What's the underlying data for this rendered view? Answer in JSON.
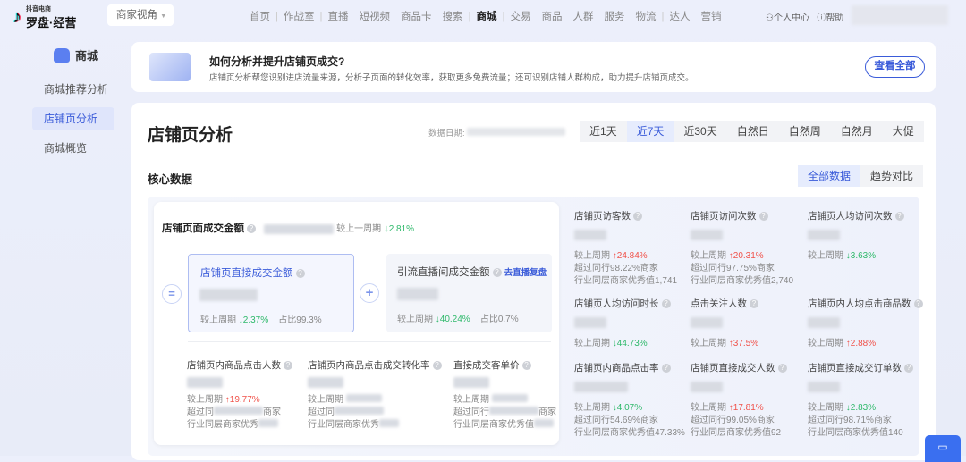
{
  "header": {
    "logo_small": "抖音电商",
    "logo": "罗盘·经营",
    "perspective": "商家视角",
    "nav": [
      "首页",
      "作战室",
      "直播",
      "短视频",
      "商品卡",
      "搜索",
      "商城",
      "交易",
      "商品",
      "人群",
      "服务",
      "物流",
      "达人",
      "营销"
    ],
    "active_nav": "商城",
    "personal": "个人中心",
    "help": "帮助"
  },
  "sidebar": {
    "title": "商城",
    "items": [
      "商城推荐分析",
      "店铺页分析",
      "商城概览"
    ],
    "active": "店铺页分析"
  },
  "banner": {
    "title": "如何分析并提升店铺页成交?",
    "desc": "店铺页分析帮您识别进店流量来源，分析子页面的转化效率，获取更多免费流量；还可识别店铺人群构成，助力提升店铺页成交。",
    "button": "查看全部"
  },
  "main": {
    "title": "店铺页分析",
    "date_label": "数据日期:",
    "filters": [
      "近1天",
      "近7天",
      "近30天",
      "自然日",
      "自然周",
      "自然月",
      "大促"
    ],
    "active_filter": "近7天",
    "section": "核心数据",
    "toggles": [
      "全部数据",
      "趋势对比"
    ],
    "active_toggle": "全部数据"
  },
  "total": {
    "label": "店铺页面成交金额",
    "compare": "较上一周期",
    "change": "2.81%"
  },
  "direct": {
    "label": "店铺页直接成交金额",
    "compare": "较上周期",
    "change": "2.37%",
    "share": "占比99.3%"
  },
  "live": {
    "label": "引流直播间成交金额",
    "link": "去直播复盘",
    "compare": "较上周期",
    "change": "40.24%",
    "share": "占比0.7%"
  },
  "sub": [
    {
      "label": "店铺页内商品点击人数",
      "compare": "较上周期",
      "change": "19.77%",
      "l2": "超过同",
      "l2b": "商家",
      "l3": "行业同层商家优秀"
    },
    {
      "label": "店铺页内商品点击成交转化率",
      "compare": "较上周期",
      "change": "",
      "l2": "超过同",
      "l2b": "",
      "l3": "行业同层商家优秀"
    },
    {
      "label": "直接成交客单价",
      "compare": "较上周期",
      "change": "",
      "l2": "超过同行",
      "l2b": "商家",
      "l3": "行业同层商家优秀值"
    }
  ],
  "metrics": [
    {
      "label": "店铺页访客数",
      "compare": "较上周期",
      "change": "24.84%",
      "dir": "up",
      "l2": "超过同行98.22%商家",
      "l3": "行业同层商家优秀值1,741"
    },
    {
      "label": "店铺页访问次数",
      "compare": "较上周期",
      "change": "20.31%",
      "dir": "up",
      "l2": "超过同行97.75%商家",
      "l3": "行业同层商家优秀值2,740"
    },
    {
      "label": "店铺页人均访问次数",
      "compare": "较上周期",
      "change": "3.63%",
      "dir": "dn",
      "l2": "",
      "l3": ""
    },
    {
      "label": "店铺页人均访问时长",
      "compare": "较上周期",
      "change": "44.73%",
      "dir": "dn",
      "l2": "",
      "l3": ""
    },
    {
      "label": "点击关注人数",
      "compare": "较上周期",
      "change": "37.5%",
      "dir": "up",
      "l2": "",
      "l3": ""
    },
    {
      "label": "店铺页内人均点击商品数",
      "compare": "较上周期",
      "change": "2.88%",
      "dir": "up",
      "l2": "",
      "l3": ""
    },
    {
      "label": "店铺页内商品点击率",
      "compare": "较上周期",
      "change": "4.07%",
      "dir": "dn",
      "l2": "超过同行54.69%商家",
      "l3": "行业同层商家优秀值47.33%"
    },
    {
      "label": "店铺页直接成交人数",
      "compare": "较上周期",
      "change": "17.81%",
      "dir": "up",
      "l2": "超过同行99.05%商家",
      "l3": "行业同层商家优秀值92"
    },
    {
      "label": "店铺页直接成交订单数",
      "compare": "较上周期",
      "change": "2.83%",
      "dir": "dn",
      "l2": "超过同行98.71%商家",
      "l3": "行业同层商家优秀值140"
    }
  ]
}
